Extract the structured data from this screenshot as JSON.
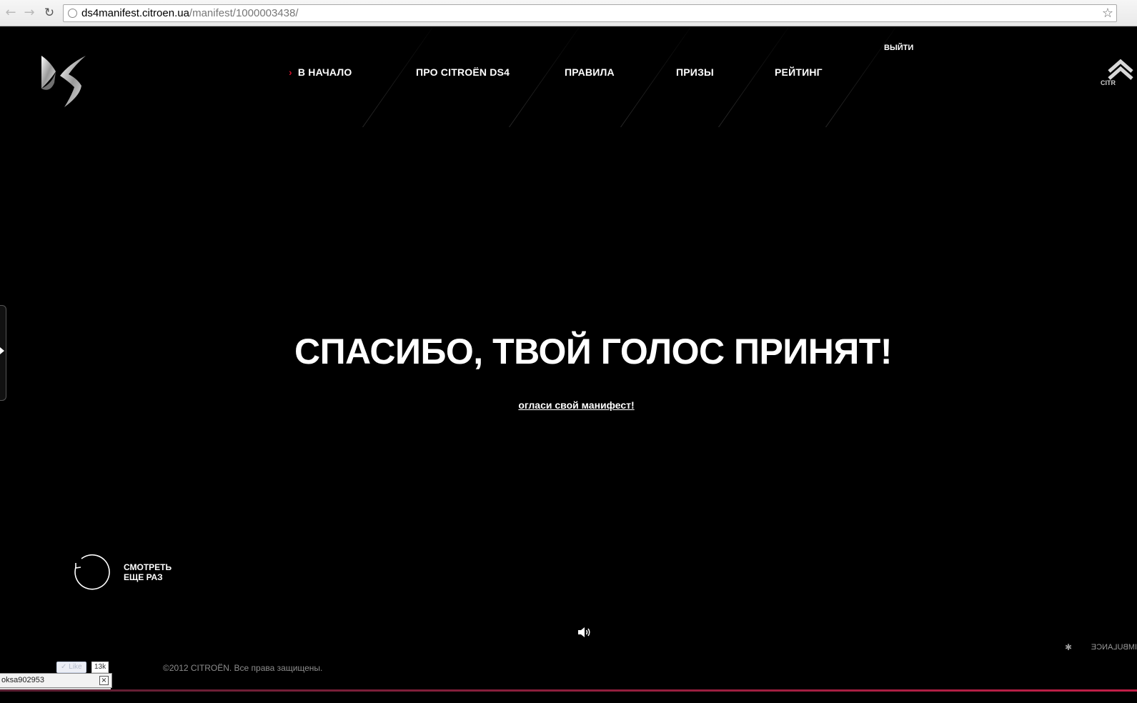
{
  "browser": {
    "back_icon": "back-arrow-icon",
    "forward_icon": "forward-arrow-icon",
    "reload_icon": "reload-icon",
    "url_host": "ds4manifest.citroen.ua",
    "url_path": "/manifest/1000003438/",
    "bookmark_icon": "star-icon"
  },
  "header": {
    "nav": [
      {
        "label": "В НАЧАЛО",
        "active": true
      },
      {
        "label": "ПРО CITROËN DS4"
      },
      {
        "label": "ПРАВИЛА"
      },
      {
        "label": "ПРИЗЫ"
      },
      {
        "label": "РЕЙТИНГ"
      }
    ],
    "logout_label": "ВЫЙТИ",
    "accent_color": "#d0112b"
  },
  "main": {
    "headline": "СПАСИБО, ТВОЙ ГОЛОС ПРИНЯТ!",
    "manifest_link": "огласи свой манифест!",
    "replay_line1": "СМОТРЕТЬ",
    "replay_line2": "ЕЩЕ РАЗ"
  },
  "footer": {
    "copyright": "©2012 CITROËN. Все права защищены.",
    "agency": "IMBULANCE",
    "like_label": "Like",
    "like_count": "13k",
    "user_name": "oksa902953"
  }
}
